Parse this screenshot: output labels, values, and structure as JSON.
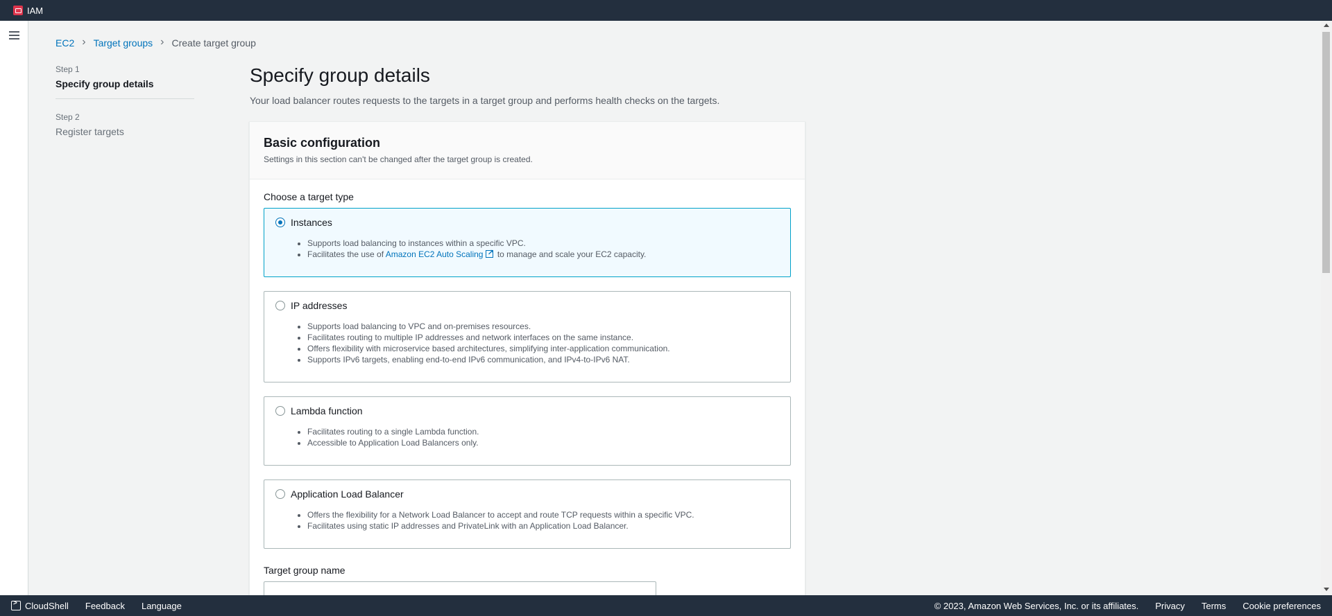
{
  "topbar": {
    "service": "IAM"
  },
  "breadcrumb": {
    "ec2": "EC2",
    "target_groups": "Target groups",
    "current": "Create target group"
  },
  "steps": {
    "step1_num": "Step 1",
    "step1_title": "Specify group details",
    "step2_num": "Step 2",
    "step2_title": "Register targets"
  },
  "main": {
    "title": "Specify group details",
    "description": "Your load balancer routes requests to the targets in a target group and performs health checks on the targets."
  },
  "basic_config": {
    "title": "Basic configuration",
    "subtitle": "Settings in this section can't be changed after the target group is created.",
    "target_type_label": "Choose a target type",
    "options": [
      {
        "label": "Instances",
        "selected": true,
        "bullets": [
          "Supports load balancing to instances within a specific VPC."
        ],
        "autoscaling_prefix": "Facilitates the use of",
        "autoscaling_link": "Amazon EC2 Auto Scaling",
        "autoscaling_suffix": "to manage and scale your EC2 capacity."
      },
      {
        "label": "IP addresses",
        "selected": false,
        "bullets": [
          "Supports load balancing to VPC and on-premises resources.",
          "Facilitates routing to multiple IP addresses and network interfaces on the same instance.",
          "Offers flexibility with microservice based architectures, simplifying inter-application communication.",
          "Supports IPv6 targets, enabling end-to-end IPv6 communication, and IPv4-to-IPv6 NAT."
        ]
      },
      {
        "label": "Lambda function",
        "selected": false,
        "bullets": [
          "Facilitates routing to a single Lambda function.",
          "Accessible to Application Load Balancers only."
        ]
      },
      {
        "label": "Application Load Balancer",
        "selected": false,
        "bullets": [
          "Offers the flexibility for a Network Load Balancer to accept and route TCP requests within a specific VPC.",
          "Facilitates using static IP addresses and PrivateLink with an Application Load Balancer."
        ]
      }
    ],
    "name_label": "Target group name",
    "name_value": ""
  },
  "footer": {
    "cloudshell": "CloudShell",
    "feedback": "Feedback",
    "language": "Language",
    "copyright": "© 2023, Amazon Web Services, Inc. or its affiliates.",
    "privacy": "Privacy",
    "terms": "Terms",
    "cookies": "Cookie preferences"
  },
  "icons": {
    "service": "iam-icon",
    "menu": "hamburger-icon",
    "external": "external-link-icon",
    "shell": "cloudshell-icon"
  },
  "colors": {
    "topbar": "#232f3e",
    "link": "#0073bb",
    "selected_border": "#00a1c9",
    "selected_bg": "#f1faff",
    "service_icon": "#dd344c"
  }
}
